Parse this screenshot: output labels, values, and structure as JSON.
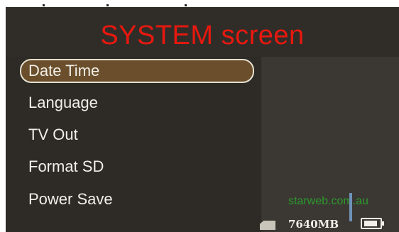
{
  "title": "SYSTEM screen",
  "menu": {
    "items": [
      {
        "label": "Date Time",
        "selected": true
      },
      {
        "label": "Language",
        "selected": false
      },
      {
        "label": "TV Out",
        "selected": false
      },
      {
        "label": "Format SD",
        "selected": false
      },
      {
        "label": "Power Save",
        "selected": false
      }
    ]
  },
  "watermark": "starweb.com.au",
  "status": {
    "storage": "7640MB",
    "storage_icon": "sd-card-icon",
    "battery_icon": "battery-icon"
  },
  "colors": {
    "title": "#e8180f",
    "selected_bg": "#6b4f2c",
    "watermark": "#2c9a2c"
  }
}
